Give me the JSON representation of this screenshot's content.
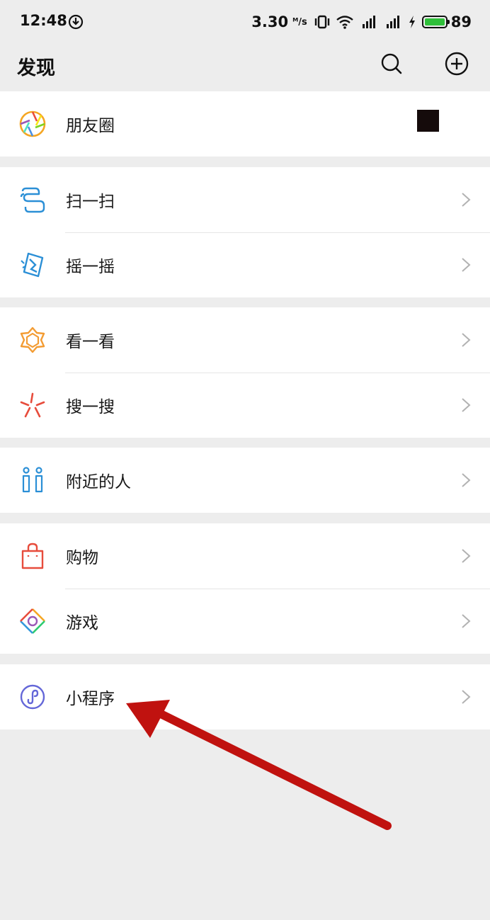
{
  "status_bar": {
    "time": "12:48",
    "network_speed": "3.30",
    "speed_unit": "ᴹ/s",
    "battery": "89",
    "battery_color": "#2fbf3a"
  },
  "header": {
    "title": "发现",
    "search_icon": "search-icon",
    "add_icon": "add-circle-icon"
  },
  "groups": [
    {
      "items": [
        {
          "label": "朋友圈",
          "icon": "moments-icon",
          "has_thumbnail": true
        }
      ]
    },
    {
      "items": [
        {
          "label": "扫一扫",
          "icon": "scan-icon"
        },
        {
          "label": "摇一摇",
          "icon": "shake-icon"
        }
      ]
    },
    {
      "items": [
        {
          "label": "看一看",
          "icon": "top-stories-icon"
        },
        {
          "label": "搜一搜",
          "icon": "search-discover-icon"
        }
      ]
    },
    {
      "items": [
        {
          "label": "附近的人",
          "icon": "people-nearby-icon"
        }
      ]
    },
    {
      "items": [
        {
          "label": "购物",
          "icon": "shopping-bag-icon"
        },
        {
          "label": "游戏",
          "icon": "games-icon"
        }
      ]
    },
    {
      "items": [
        {
          "label": "小程序",
          "icon": "mini-programs-icon"
        }
      ]
    }
  ],
  "annotation": {
    "arrow_color": "#c0120f"
  }
}
